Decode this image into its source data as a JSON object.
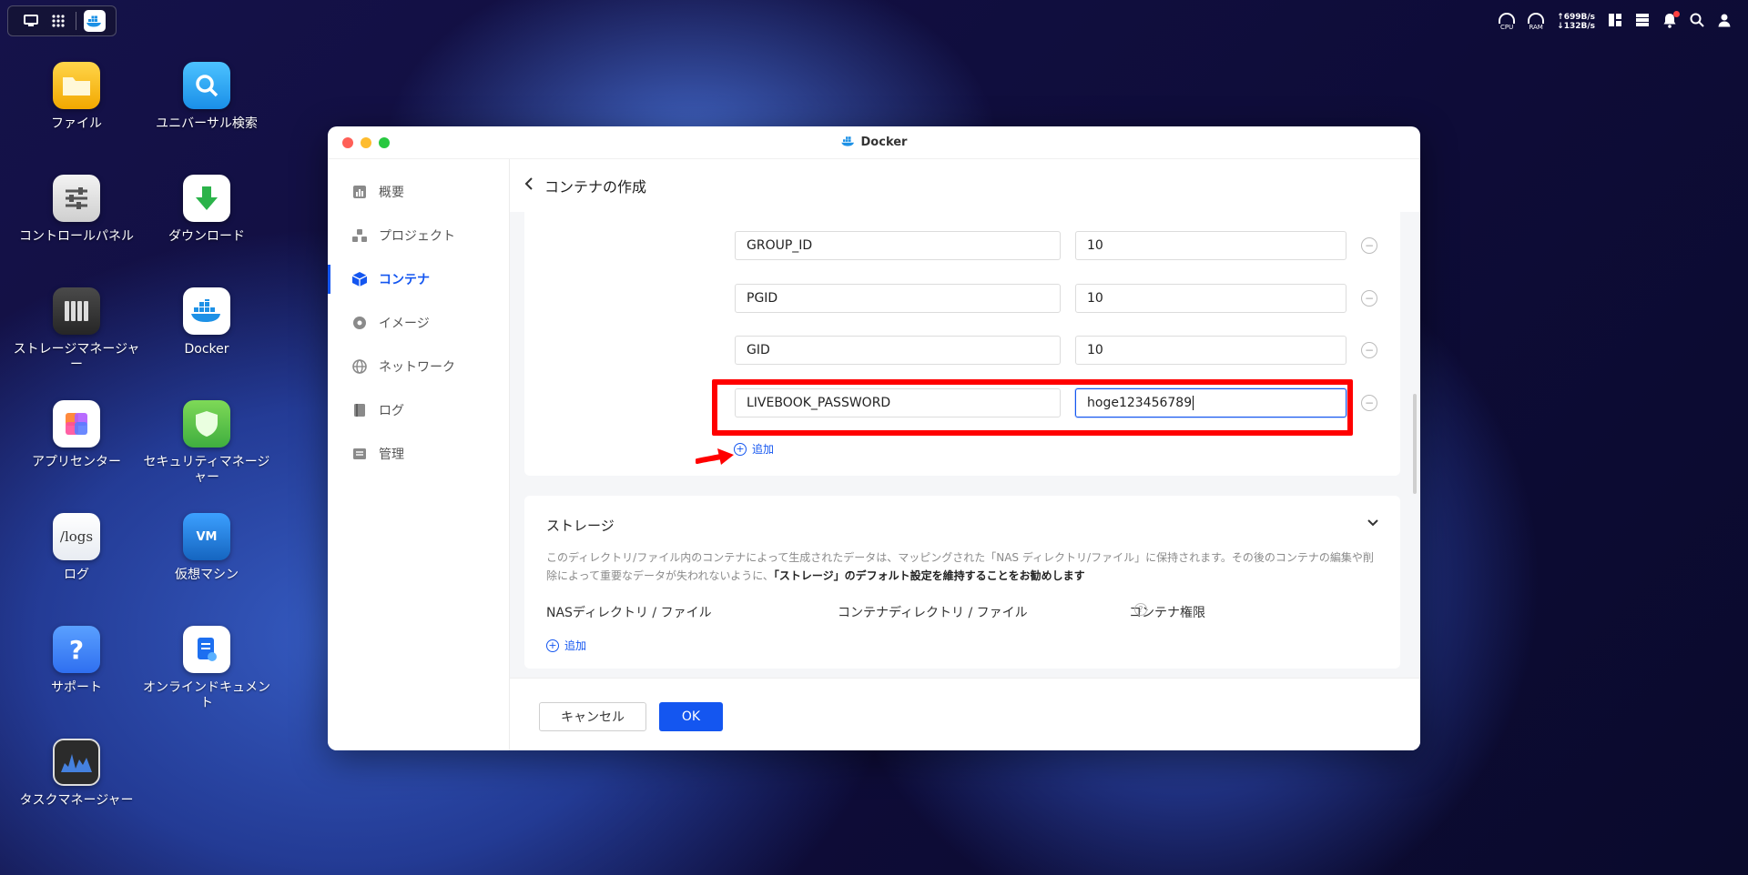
{
  "topbar": {
    "cpu_label": "CPU",
    "ram_label": "RAM",
    "net_up": "↑699B/s",
    "net_down": "↓132B/s"
  },
  "desktop": {
    "icons": [
      {
        "label": "ファイル",
        "icon": "folder-icon",
        "color": "#f5b800"
      },
      {
        "label": "ユニバーサル検索",
        "icon": "search-icon",
        "color": "#2aa4f4"
      },
      {
        "label": "コントロールパネル",
        "icon": "sliders-icon",
        "color": "#e6e6e6"
      },
      {
        "label": "ダウンロード",
        "icon": "download-icon",
        "color": "#ffffff"
      },
      {
        "label": "ストレージマネージャー",
        "icon": "storage-icon",
        "color": "#3a3a3a"
      },
      {
        "label": "Docker",
        "icon": "docker-icon",
        "color": "#ffffff"
      },
      {
        "label": "アプリセンター",
        "icon": "appcenter-icon",
        "color": "#ffffff"
      },
      {
        "label": "セキュリティマネージャー",
        "icon": "shield-icon",
        "color": "#5ac85a"
      },
      {
        "label": "ログ",
        "icon": "logs-icon",
        "color": "#ffffff",
        "tile_text": "/logs"
      },
      {
        "label": "仮想マシン",
        "icon": "vm-icon",
        "color": "#1e88e5",
        "tile_text": "VM"
      },
      {
        "label": "サポート",
        "icon": "help-icon",
        "color": "#2f7bf5",
        "tile_text": "?"
      },
      {
        "label": "オンラインドキュメント",
        "icon": "document-icon",
        "color": "#ffffff"
      },
      {
        "label": "タスクマネージャー",
        "icon": "task-manager-icon",
        "color": "#2a2a2a"
      }
    ]
  },
  "window": {
    "title": "Docker",
    "sidebar": [
      {
        "label": "概要",
        "icon": "overview-icon",
        "active": false
      },
      {
        "label": "プロジェクト",
        "icon": "project-icon",
        "active": false
      },
      {
        "label": "コンテナ",
        "icon": "container-icon",
        "active": true
      },
      {
        "label": "イメージ",
        "icon": "image-icon",
        "active": false
      },
      {
        "label": "ネットワーク",
        "icon": "network-icon",
        "active": false
      },
      {
        "label": "ログ",
        "icon": "log-icon",
        "active": false
      },
      {
        "label": "管理",
        "icon": "manage-icon",
        "active": false
      }
    ],
    "header": {
      "title": "コンテナの作成"
    },
    "env_vars": [
      {
        "key": "GROUP_ID",
        "value": "10"
      },
      {
        "key": "PGID",
        "value": "10"
      },
      {
        "key": "GID",
        "value": "10"
      },
      {
        "key": "LIVEBOOK_PASSWORD",
        "value": "hoge123456789"
      }
    ],
    "add_label": "追加",
    "storage": {
      "title": "ストレージ",
      "desc_1": "このディレクトリ/ファイル内のコンテナによって生成されたデータは、マッピングされた「NAS ディレクトリ/ファイル」に保持されます。その後のコンテナの編集や削",
      "desc_2": "除によって重要なデータが失われないように、",
      "desc_bold": "「ストレージ」のデフォルト設定を維持することをお勧めします",
      "col_nas": "NASディレクトリ / ファイル",
      "col_container": "コンテナディレクトリ / ファイル",
      "col_permission": "コンテナ権限",
      "add_label": "追加"
    },
    "footer": {
      "cancel": "キャンセル",
      "ok": "OK"
    }
  },
  "colors": {
    "accent": "#1456f0",
    "highlight": "#ff0000"
  }
}
